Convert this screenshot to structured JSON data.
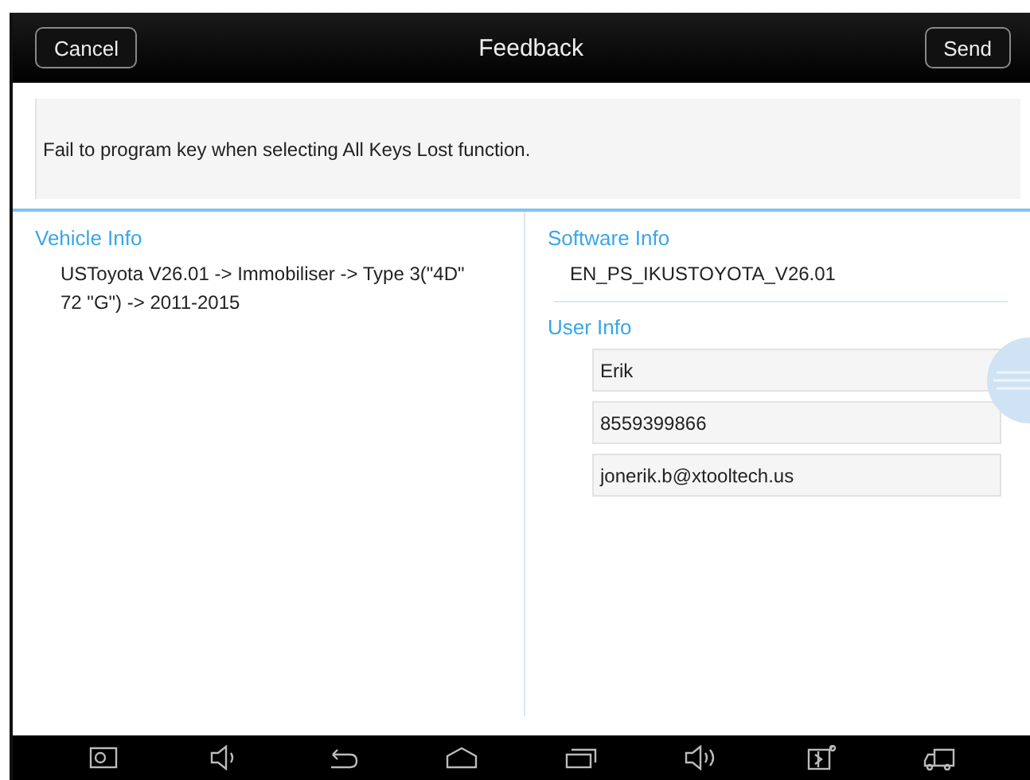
{
  "header": {
    "cancel": "Cancel",
    "title": "Feedback",
    "send": "Send"
  },
  "feedback": {
    "value": "Fail to program key when selecting All Keys Lost function."
  },
  "vehicle_info": {
    "heading": "Vehicle Info",
    "text": "USToyota V26.01 -> Immobiliser -> Type 3(\"4D\" 72 \"G\") -> 2011-2015"
  },
  "software_info": {
    "heading": "Software Info",
    "text": "EN_PS_IKUSTOYOTA_V26.01"
  },
  "user_info": {
    "heading": "User Info",
    "fields": [
      {
        "value": "Erik"
      },
      {
        "value": "8559399866"
      },
      {
        "value": "jonerik.b@xtooltech.us"
      }
    ]
  },
  "nav_bar": [
    {
      "kind": "screenshot"
    },
    {
      "kind": "volume-down"
    },
    {
      "kind": "back"
    },
    {
      "kind": "home"
    },
    {
      "kind": "recent"
    },
    {
      "kind": "volume-up"
    },
    {
      "kind": "device"
    },
    {
      "kind": "truck"
    }
  ]
}
